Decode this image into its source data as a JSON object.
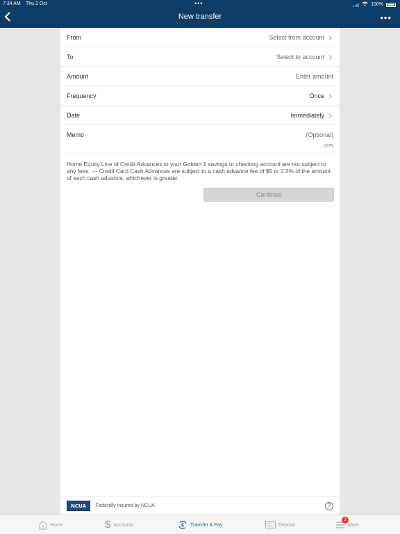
{
  "status_bar": {
    "time": "7:34 AM",
    "date": "Thu 2 Oct",
    "battery": "100%"
  },
  "header": {
    "title": "New transfer",
    "background_color": "#0d3c66"
  },
  "form": {
    "rows": [
      {
        "label": "From",
        "value": "Select from account"
      },
      {
        "label": "To",
        "value": "Select to account"
      },
      {
        "label": "Amount",
        "value": "Enter amount"
      },
      {
        "label": "Frequency",
        "value": "Once"
      },
      {
        "label": "Date",
        "value": "Immediately"
      }
    ],
    "memo": {
      "label": "Memo",
      "placeholder": "(Optional)",
      "counter": "0/75"
    },
    "notice": "Home Equity Line of Credit Advances to your Golden 1 savings or checking account are not subject to any fees.  ---  Credit Card Cash Advances are subject to a cash advance fee of $5 or 2.5% of the amount of each cash advance, whichever is greater.",
    "continue_label": "Continue"
  },
  "footer": {
    "logo_text": "NCUA",
    "insured_text": "Federally insured by NCUA",
    "help_label": "?"
  },
  "tabbar": {
    "tabs": [
      {
        "label": "Home",
        "icon": "home-icon"
      },
      {
        "label": "Accounts",
        "icon": "dollar-icon"
      },
      {
        "label": "Transfer & Pay",
        "icon": "transfer-icon",
        "active": true
      },
      {
        "label": "Deposit",
        "icon": "check-deposit-icon"
      },
      {
        "label": "More",
        "icon": "menu-icon",
        "badge": "3"
      }
    ],
    "active_color": "#1f5a8f"
  }
}
